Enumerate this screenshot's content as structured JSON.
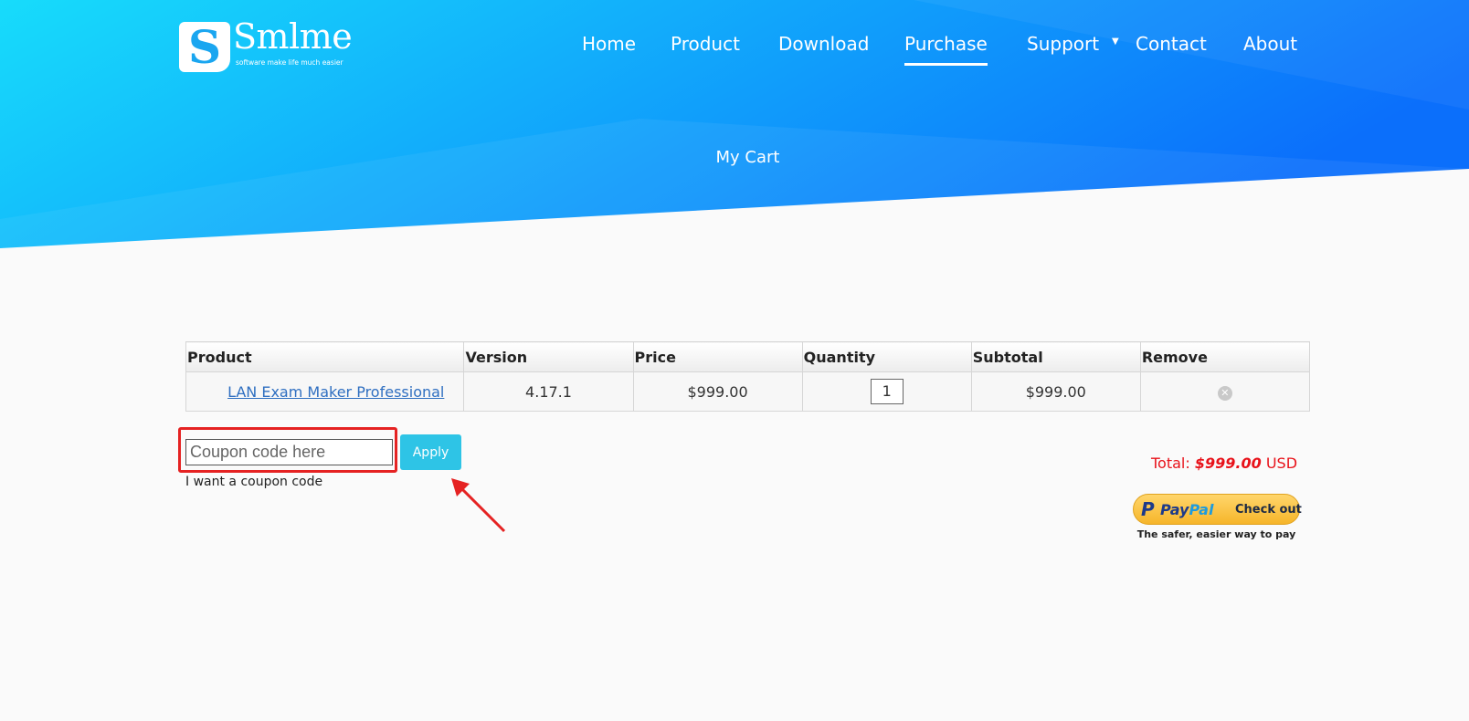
{
  "brand": {
    "logo_letter": "S",
    "name": "Smlme",
    "tagline": "software make life much easier"
  },
  "nav": {
    "items": [
      {
        "label": "Home"
      },
      {
        "label": "Product"
      },
      {
        "label": "Download"
      },
      {
        "label": "Purchase",
        "active": true
      },
      {
        "label": "Support",
        "has_dropdown": true
      },
      {
        "label": "Contact"
      },
      {
        "label": "About"
      }
    ],
    "dropdown_icon": "caret-down-icon"
  },
  "page": {
    "title": "My Cart"
  },
  "cart": {
    "headers": [
      "Product",
      "Version",
      "Price",
      "Quantity",
      "Subtotal",
      "Remove"
    ],
    "rows": [
      {
        "product": "LAN Exam Maker Professional",
        "version": "4.17.1",
        "price": "$999.00",
        "quantity": "1",
        "subtotal": "$999.00",
        "remove_icon": "remove-circle-icon"
      }
    ]
  },
  "coupon": {
    "placeholder": "Coupon code here",
    "value": "",
    "apply_label": "Apply",
    "want_link": "I want a coupon code"
  },
  "total": {
    "label": "Total:",
    "amount": "$999.00",
    "currency": "USD"
  },
  "paypal": {
    "logo_letter": "P",
    "word_pay": "Pay",
    "word_pal": "Pal",
    "button_label": "Check out",
    "tagline": "The safer, easier way to pay"
  },
  "colors": {
    "banner_start": "#16d4fa",
    "banner_end": "#0d73fb",
    "accent": "#2ec4e6",
    "highlight": "#e52222",
    "total": "#e8121a"
  }
}
